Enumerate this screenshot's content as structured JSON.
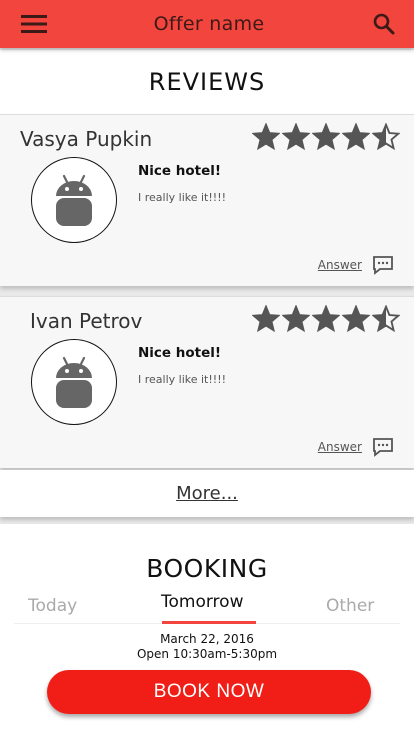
{
  "appbar": {
    "title": "Offer name",
    "menu_icon": "hamburger-menu-icon",
    "search_icon": "search-icon",
    "color": "#f1453d"
  },
  "reviews": {
    "title": "REVIEWS",
    "items": [
      {
        "author": "Vasya Pupkin",
        "rating": 4.5,
        "title": "Nice hotel!",
        "text": "I really like it!!!!",
        "answer_label": "Answer"
      },
      {
        "author": "Ivan Petrov",
        "rating": 4.5,
        "title": "Nice hotel!",
        "text": "I really like it!!!!",
        "answer_label": "Answer"
      }
    ],
    "more_label": "More..."
  },
  "booking": {
    "title": "BOOKING",
    "tabs": [
      "Today",
      "Tomorrow",
      "Other"
    ],
    "selected_tab": "Tomorrow",
    "date": "March 22, 2016",
    "hours": "Open 10:30am-5:30pm",
    "button_label": "BOOK NOW",
    "accent": "#f01e16"
  }
}
